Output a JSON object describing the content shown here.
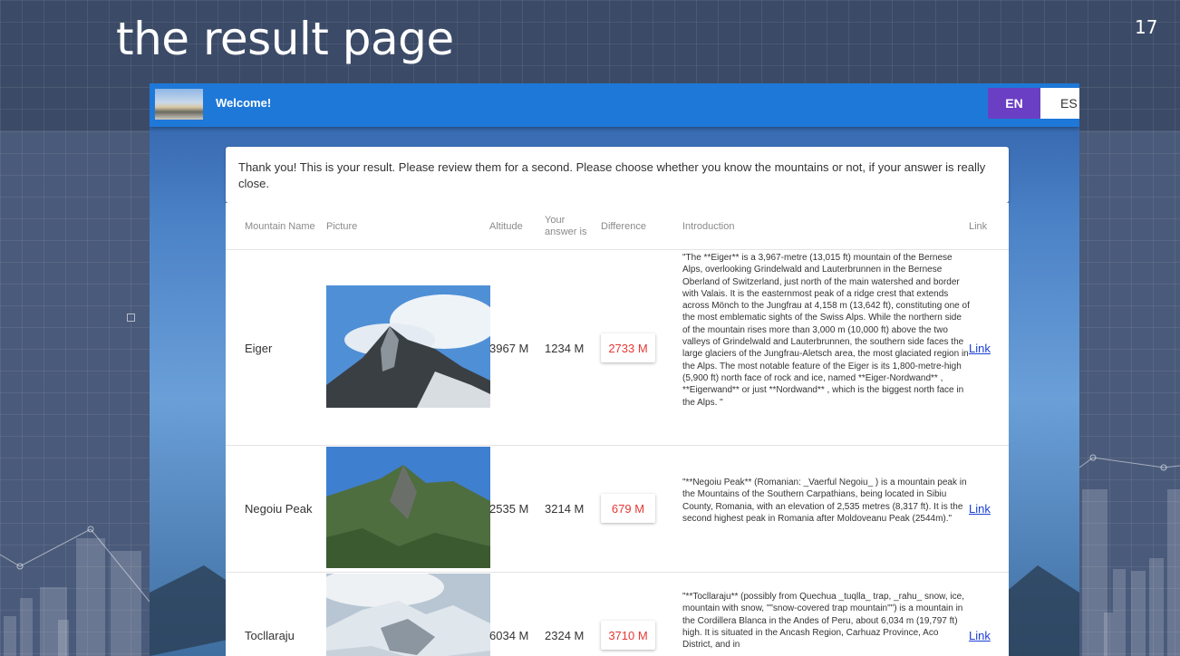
{
  "slide": {
    "title": "the result page",
    "number": "17"
  },
  "app": {
    "header": {
      "welcome": "Welcome!",
      "lang_en": "EN",
      "lang_es": "ES"
    },
    "notice": "Thank you! This is your result. Please review them for a second. Please choose whether you know the mountains or not, if your answer is really close.",
    "table": {
      "headers": {
        "name": "Mountain Name",
        "picture": "Picture",
        "altitude": "Altitude",
        "answer": "Your answer is",
        "difference": "Difference",
        "introduction": "Introduction",
        "link": "Link"
      },
      "rows": [
        {
          "name": "Eiger",
          "altitude": "3967 M",
          "answer": "1234 M",
          "difference": "2733 M",
          "introduction": "\"The **Eiger** is a 3,967-metre (13,015 ft) mountain of the Bernese Alps, overlooking Grindelwald and Lauterbrunnen in the Bernese Oberland of Switzerland, just north of the main watershed and border with Valais. It is the easternmost peak of a ridge crest that extends across Mönch to the Jungfrau at 4,158 m (13,642 ft), constituting one of the most emblematic sights of the Swiss Alps. While the northern side of the mountain rises more than 3,000 m (10,000 ft) above the two valleys of Grindelwald and Lauterbrunnen, the southern side faces the large glaciers of the Jungfrau-Aletsch area, the most glaciated region in the Alps. The most notable feature of the Eiger is its 1,800-metre-high (5,900 ft) north face of rock and ice, named **Eiger-Nordwand** , **Eigerwand** or just **Nordwand** , which is the biggest north face in the Alps. \"",
          "link": "Link"
        },
        {
          "name": "Negoiu Peak",
          "altitude": "2535 M",
          "answer": "3214 M",
          "difference": "679 M",
          "introduction": "\"**Negoiu Peak** (Romanian: _Vaerful Negoiu_ ) is a mountain peak in the Mountains of the Southern Carpathians, being located in Sibiu County, Romania, with an elevation of 2,535 metres (8,317 ft). It is the second highest peak in Romania after Moldoveanu Peak (2544m).\"",
          "link": "Link"
        },
        {
          "name": "Tocllaraju",
          "altitude": "6034 M",
          "answer": "2324 M",
          "difference": "3710 M",
          "introduction": "\"**Tocllaraju** (possibly from Quechua _tuqlla_ trap, _rahu_ snow, ice, mountain with snow, \"\"snow-covered trap mountain\"\") is a mountain in the Cordillera Blanca in the Andes of Peru, about 6,034 m (19,797 ft) high. It is situated in the Ancash Region, Carhuaz Province, Aco District, and in",
          "link": "Link"
        }
      ]
    }
  },
  "colors": {
    "header": "#1e78d8",
    "lang_active": "#6b3fc4",
    "difference_text": "#e53935",
    "link": "#1a3fd6"
  }
}
